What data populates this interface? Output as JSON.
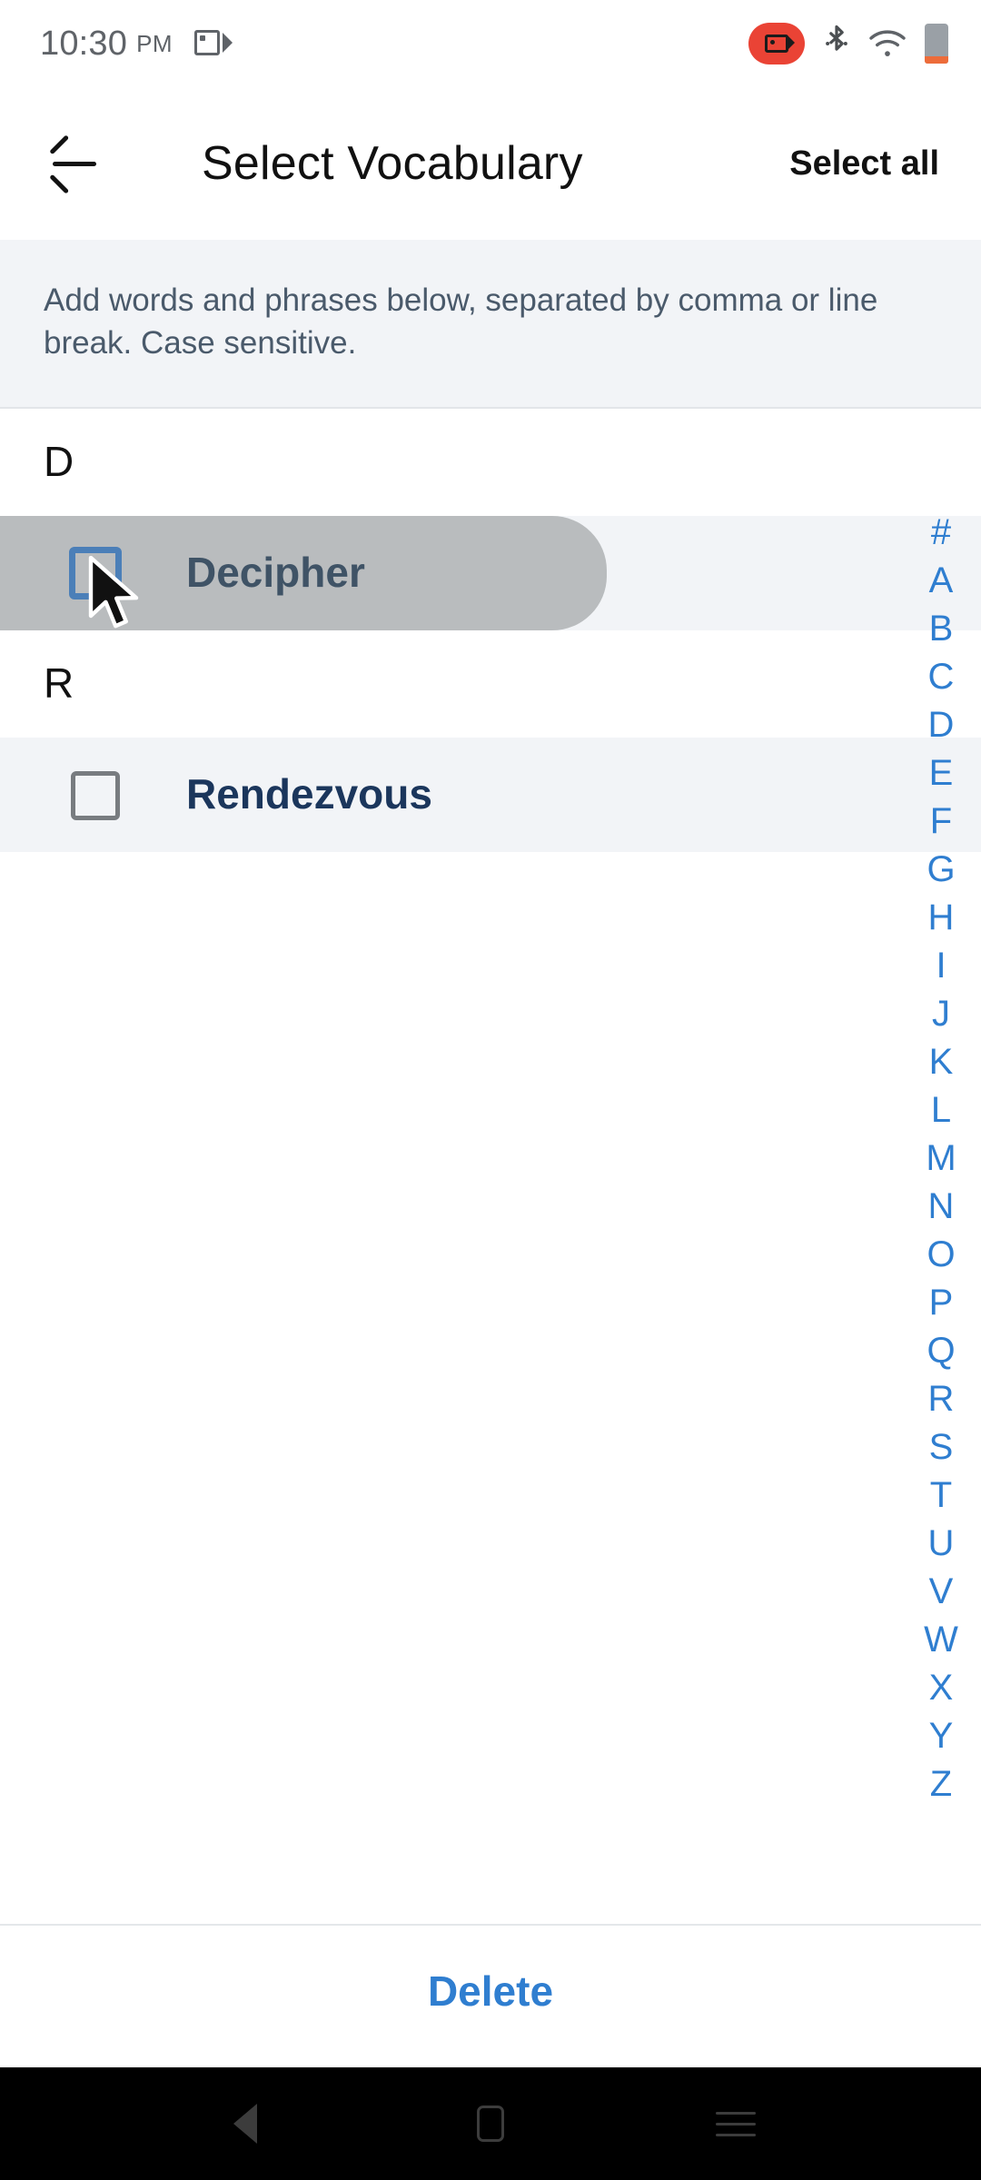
{
  "status_bar": {
    "time": "10:30",
    "meridiem": "PM",
    "icons": [
      "screen-record-icon",
      "recording-badge-icon",
      "bluetooth-icon",
      "wifi-icon",
      "battery-icon"
    ]
  },
  "app_bar": {
    "back_label": "back-arrow-icon",
    "title": "Select Vocabulary",
    "select_all": "Select all"
  },
  "banner": {
    "text": "Add words and phrases below, separated by comma or line break. Case sensitive."
  },
  "list": {
    "sections": [
      {
        "letter": "D",
        "items": [
          {
            "word": "Decipher",
            "checked": false,
            "pressed": true,
            "focused": true
          }
        ]
      },
      {
        "letter": "R",
        "items": [
          {
            "word": "Rendezvous",
            "checked": false,
            "pressed": false,
            "focused": false
          }
        ]
      }
    ]
  },
  "alpha_index": {
    "letters": [
      "#",
      "A",
      "B",
      "C",
      "D",
      "E",
      "F",
      "G",
      "H",
      "I",
      "J",
      "K",
      "L",
      "M",
      "N",
      "O",
      "P",
      "Q",
      "R",
      "S",
      "T",
      "U",
      "V",
      "W",
      "X",
      "Y",
      "Z"
    ]
  },
  "bottom_bar": {
    "delete_label": "Delete"
  },
  "nav_bar": {
    "back": "nav-back-icon",
    "home": "nav-home-icon",
    "recent": "nav-recent-icon"
  },
  "colors": {
    "accent_blue": "#2f7ed0",
    "record_red": "#ea4335",
    "word_navy": "#1b365c",
    "banner_bg": "#f2f4f7",
    "ripple_gray": "#b9bcbe"
  }
}
